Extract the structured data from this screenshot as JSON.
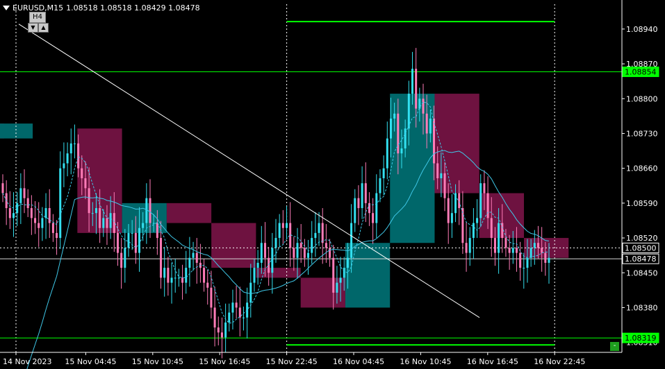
{
  "header": {
    "symbol": "EURUSD,M15",
    "ohlc": "1.08518 1.08518 1.08429 1.08478"
  },
  "timeframe": {
    "label": "H4",
    "down_arrow": "▼",
    "up_arrow": "▲"
  },
  "corner_button": "-",
  "colors": {
    "background": "#000000",
    "bull_candle": "#33e0f0",
    "bear_candle": "#ff7cb8",
    "bull_box": "#00676a",
    "bear_box": "#6e1240",
    "level_line": "#00ff00",
    "ma_line": "#3fc8e8",
    "trendline": "#ffffff"
  },
  "chart_data": {
    "type": "candlestick",
    "symbol": "EURUSD",
    "timeframe": "M15",
    "ylim": [
      1.0829,
      1.0899
    ],
    "y_ticks": [
      "1.08940",
      "1.08870",
      "1.08800",
      "1.08730",
      "1.08660",
      "1.08590",
      "1.08520",
      "1.08450",
      "1.08380",
      "1.08310"
    ],
    "x_ticks": [
      "14 Nov 2023",
      "15 Nov 04:45",
      "15 Nov 10:45",
      "15 Nov 16:45",
      "15 Nov 22:45",
      "16 Nov 04:45",
      "16 Nov 10:45",
      "16 Nov 16:45",
      "16 Nov 22:45"
    ],
    "grid": false,
    "price_labels": [
      {
        "text": "1.08854",
        "value": 1.08854,
        "style": "green"
      },
      {
        "text": "1.08500",
        "value": 1.085,
        "style": "white"
      },
      {
        "text": "1.08478",
        "value": 1.08478,
        "style": "white"
      },
      {
        "text": "1.08319",
        "value": 1.08319,
        "style": "green"
      }
    ],
    "levels": [
      {
        "value": 1.08854,
        "kind": "full-width"
      },
      {
        "value": 1.08319,
        "kind": "full-width"
      },
      {
        "value": 1.08955,
        "kind": "segment",
        "x_from": "15 Nov 22:45",
        "x_to": "16 Nov 22:45"
      },
      {
        "value": 1.08305,
        "kind": "segment",
        "x_from": "15 Nov 22:45",
        "x_to": "16 Nov 22:45"
      }
    ],
    "current_price": 1.08478,
    "h4_boxes": [
      {
        "start": "14 Nov 2023",
        "open": 1.0875,
        "close": 1.0872,
        "high": 1.0879,
        "low": 1.0866
      },
      {
        "start": "14 Nov 20:00",
        "open": 1.0872,
        "close": 1.0875,
        "high": 1.0878,
        "low": 1.0868
      },
      {
        "start": "15 Nov 04:00",
        "open": 1.0874,
        "close": 1.0853,
        "high": 1.0884,
        "low": 1.0848
      },
      {
        "start": "15 Nov 08:00",
        "open": 1.0853,
        "close": 1.0859,
        "high": 1.0875,
        "low": 1.0842
      },
      {
        "start": "15 Nov 12:00",
        "open": 1.0859,
        "close": 1.0855,
        "high": 1.0869,
        "low": 1.0839
      },
      {
        "start": "15 Nov 16:00",
        "open": 1.0855,
        "close": 1.0846,
        "high": 1.0862,
        "low": 1.0841
      },
      {
        "start": "15 Nov 20:00",
        "open": 1.0846,
        "close": 1.0844,
        "high": 1.0855,
        "low": 1.084
      },
      {
        "start": "16 Nov 00:00",
        "open": 1.0844,
        "close": 1.0838,
        "high": 1.0852,
        "low": 1.0831
      },
      {
        "start": "16 Nov 04:00",
        "open": 1.0838,
        "close": 1.0851,
        "high": 1.0855,
        "low": 1.0833
      },
      {
        "start": "16 Nov 08:00",
        "open": 1.0851,
        "close": 1.0881,
        "high": 1.0887,
        "low": 1.0841
      },
      {
        "start": "16 Nov 12:00",
        "open": 1.0881,
        "close": 1.0861,
        "high": 1.0894,
        "low": 1.0849
      },
      {
        "start": "16 Nov 16:00",
        "open": 1.0861,
        "close": 1.0852,
        "high": 1.0866,
        "low": 1.0845
      },
      {
        "start": "16 Nov 20:00",
        "open": 1.0852,
        "close": 1.0848,
        "high": 1.0853,
        "low": 1.0844
      }
    ],
    "candles_close": [
      1.0861,
      1.0858,
      1.0856,
      1.0857,
      1.0859,
      1.0862,
      1.086,
      1.0858,
      1.0856,
      1.0855,
      1.0854,
      1.0856,
      1.0858,
      1.0855,
      1.0853,
      1.0852,
      1.0866,
      1.0867,
      1.0869,
      1.0871,
      1.0871,
      1.0866,
      1.0864,
      1.0862,
      1.0857,
      1.0857,
      1.0858,
      1.0854,
      1.0856,
      1.0854,
      1.0857,
      1.0853,
      1.0849,
      1.0846,
      1.085,
      1.0853,
      1.0853,
      1.0849,
      1.0854,
      1.0855,
      1.086,
      1.0855,
      1.0855,
      1.0852,
      1.0844,
      1.0846,
      1.0843,
      1.0844,
      1.0844,
      1.0844,
      1.0843,
      1.0846,
      1.0848,
      1.0849,
      1.0847,
      1.0846,
      1.0843,
      1.0842,
      1.0838,
      1.0834,
      1.0833,
      1.0832,
      1.0835,
      1.0837,
      1.0839,
      1.0838,
      1.0836,
      1.0836,
      1.0839,
      1.0843,
      1.0846,
      1.0847,
      1.0851,
      1.0848,
      1.0845,
      1.085,
      1.0852,
      1.0855,
      1.0854,
      1.0855,
      1.085,
      1.0848,
      1.0851,
      1.085,
      1.0848,
      1.0849,
      1.0852,
      1.0853,
      1.0855,
      1.0851,
      1.085,
      1.0848,
      1.0841,
      1.0843,
      1.0844,
      1.0846,
      1.0848,
      1.0855,
      1.086,
      1.0858,
      1.0863,
      1.0859,
      1.0857,
      1.0855,
      1.0861,
      1.0864,
      1.0866,
      1.0872,
      1.0876,
      1.0877,
      1.0869,
      1.087,
      1.0874,
      1.0881,
      1.0886,
      1.0878,
      1.088,
      1.0877,
      1.0873,
      1.0876,
      1.0867,
      1.0864,
      1.0865,
      1.086,
      1.0855,
      1.0857,
      1.0861,
      1.0858,
      1.0851,
      1.0849,
      1.0852,
      1.0855,
      1.0856,
      1.0863,
      1.0861,
      1.0856,
      1.0852,
      1.0849,
      1.0855,
      1.0852,
      1.085,
      1.0849,
      1.085,
      1.0849,
      1.0846,
      1.0846,
      1.0848,
      1.085,
      1.0851,
      1.085,
      1.0849,
      1.0847,
      1.0848
    ],
    "trendline": {
      "from": {
        "x": "14 Nov 2023",
        "y": 1.0895
      },
      "to": {
        "x": "16 Nov 14:00",
        "y": 1.0836
      }
    }
  }
}
